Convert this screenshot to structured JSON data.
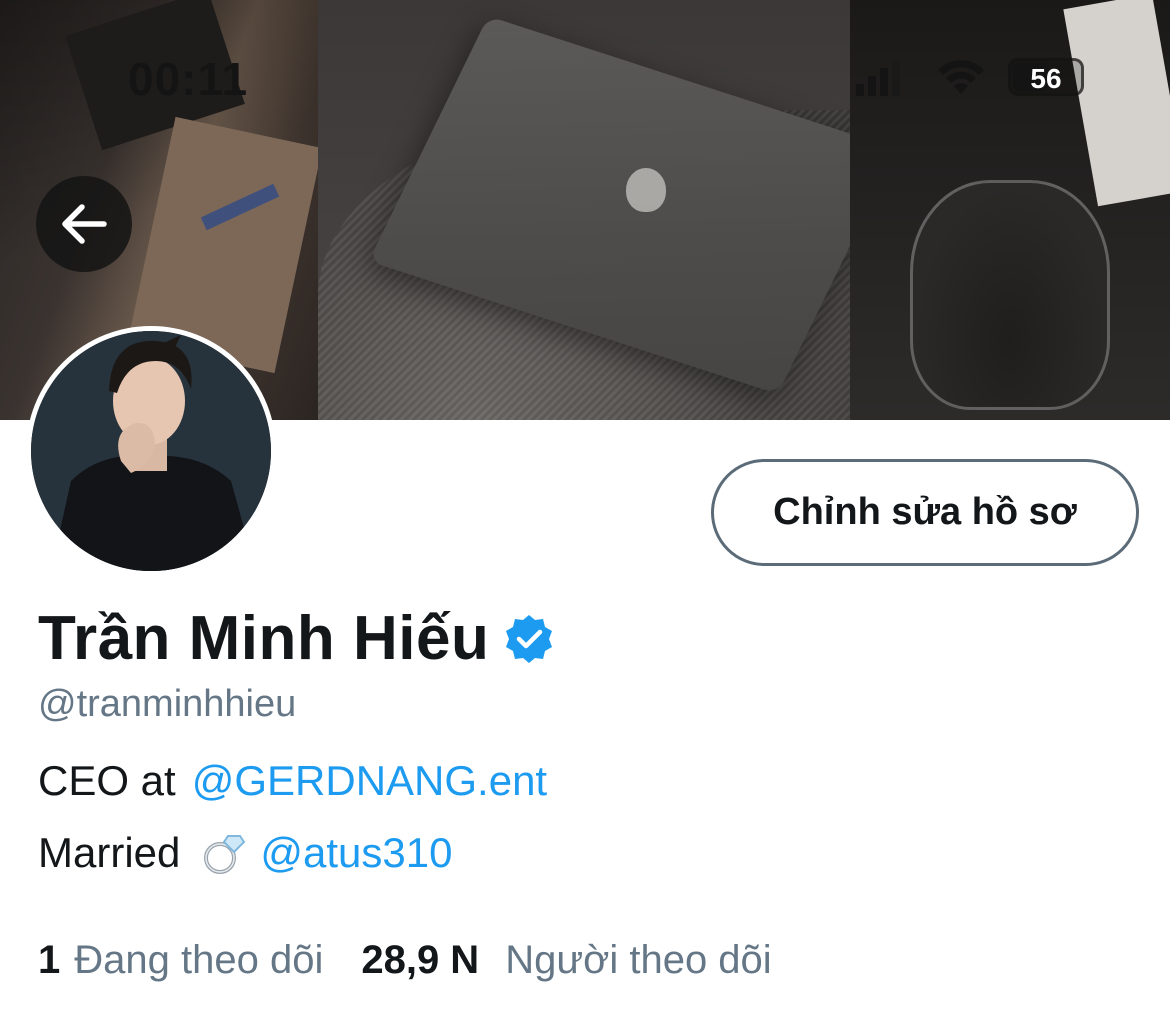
{
  "status_bar": {
    "time": "00:11",
    "battery": "56",
    "battery_level": 0.56
  },
  "header": {
    "back_icon": "arrow-left-icon"
  },
  "profile": {
    "edit_button_label": "Chỉnh sửa hồ sơ",
    "display_name": "Trần Minh Hiếu",
    "verified": true,
    "handle": "@tranminhhieu",
    "bio": {
      "line1_text": "CEO at",
      "line1_link": "@GERDNANG.ent",
      "line2_text": "Married",
      "line2_emoji": "ring-icon",
      "line2_link": "@atus310"
    }
  },
  "stats": {
    "following_count": "1",
    "following_label": "Đang theo dõi",
    "followers_count": "28,9 N",
    "followers_label": "Người theo dõi"
  },
  "colors": {
    "link": "#1d9bf0",
    "secondary_text": "#657786",
    "primary_text": "#14171a",
    "verified": "#1d9bf0"
  }
}
